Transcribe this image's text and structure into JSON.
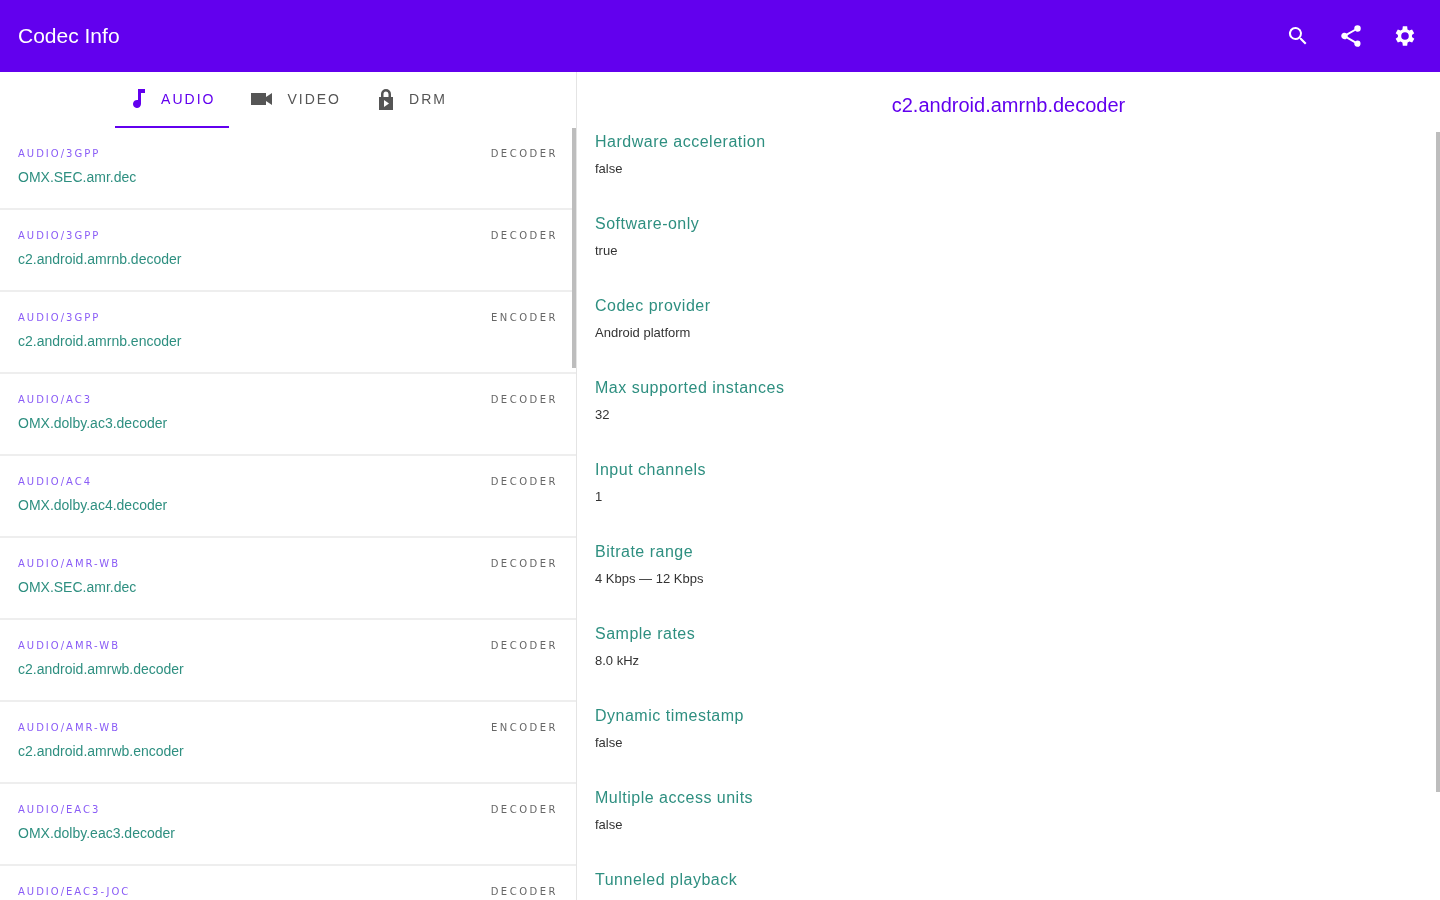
{
  "app_bar": {
    "title": "Codec Info"
  },
  "tabs": [
    {
      "label": "AUDIO",
      "kind": "music",
      "selected": true
    },
    {
      "label": "VIDEO",
      "kind": "video",
      "selected": false
    },
    {
      "label": "DRM",
      "kind": "lock",
      "selected": false
    }
  ],
  "codecs": [
    {
      "mime": "AUDIO/3GPP",
      "type": "DECODER",
      "name": "OMX.SEC.amr.dec"
    },
    {
      "mime": "AUDIO/3GPP",
      "type": "DECODER",
      "name": "c2.android.amrnb.decoder"
    },
    {
      "mime": "AUDIO/3GPP",
      "type": "ENCODER",
      "name": "c2.android.amrnb.encoder"
    },
    {
      "mime": "AUDIO/AC3",
      "type": "DECODER",
      "name": "OMX.dolby.ac3.decoder"
    },
    {
      "mime": "AUDIO/AC4",
      "type": "DECODER",
      "name": "OMX.dolby.ac4.decoder"
    },
    {
      "mime": "AUDIO/AMR-WB",
      "type": "DECODER",
      "name": "OMX.SEC.amr.dec"
    },
    {
      "mime": "AUDIO/AMR-WB",
      "type": "DECODER",
      "name": "c2.android.amrwb.decoder"
    },
    {
      "mime": "AUDIO/AMR-WB",
      "type": "ENCODER",
      "name": "c2.android.amrwb.encoder"
    },
    {
      "mime": "AUDIO/EAC3",
      "type": "DECODER",
      "name": "OMX.dolby.eac3.decoder"
    },
    {
      "mime": "AUDIO/EAC3-JOC",
      "type": "DECODER"
    }
  ],
  "detail": {
    "title": "c2.android.amrnb.decoder",
    "properties": [
      {
        "label": "Hardware acceleration",
        "value": "false"
      },
      {
        "label": "Software-only",
        "value": "true"
      },
      {
        "label": "Codec provider",
        "value": "Android platform"
      },
      {
        "label": "Max supported instances",
        "value": "32"
      },
      {
        "label": "Input channels",
        "value": "1"
      },
      {
        "label": "Bitrate range",
        "value": "4 Kbps — 12 Kbps"
      },
      {
        "label": "Sample rates",
        "value": "8.0 kHz"
      },
      {
        "label": "Dynamic timestamp",
        "value": "false"
      },
      {
        "label": "Multiple access units",
        "value": "false"
      },
      {
        "label": "Tunneled playback"
      }
    ]
  }
}
